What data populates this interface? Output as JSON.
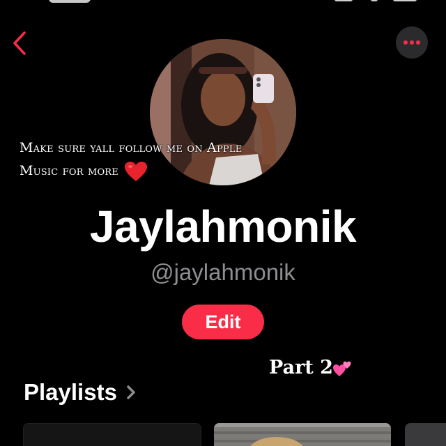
{
  "header": {
    "back_icon": "chevron-left-icon",
    "more_icon": "ellipsis-icon"
  },
  "profile": {
    "display_name": "Jaylahmonik",
    "handle": "@jaylahmonik",
    "edit_label": "Edit"
  },
  "overlay": {
    "line1": "Make sure yall follow me on Apple",
    "line2": "Music for more",
    "heart_emoji": "red-heart-emoji"
  },
  "caption": {
    "part_label": "Part 2",
    "hearts_emoji": "two-hearts-emoji"
  },
  "playlists": {
    "heading": "Playlists",
    "chevron_icon": "chevron-right-icon"
  },
  "colors": {
    "accent": "#fa2d48",
    "background": "#000000",
    "secondary_text": "#8d8d92",
    "button_bg": "#2b2b2d"
  }
}
